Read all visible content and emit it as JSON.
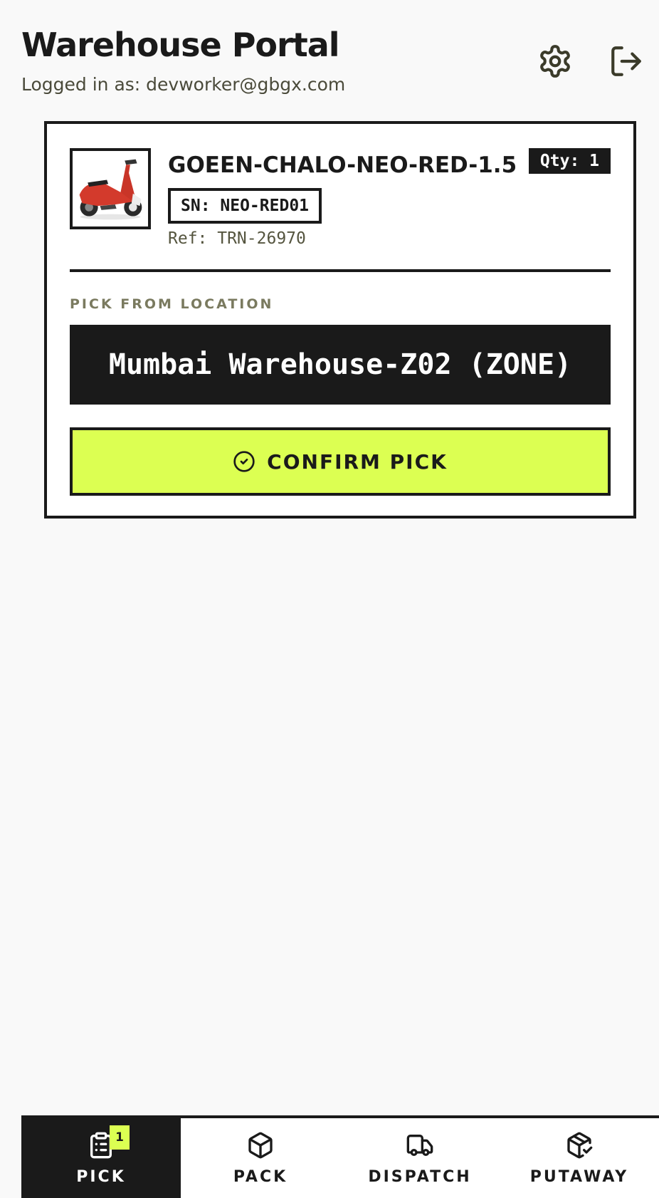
{
  "header": {
    "title": "Warehouse Portal",
    "logged_in": "Logged in as: devworker@gbgx.com",
    "settings_icon": "settings-gear-icon",
    "logout_icon": "logout-icon"
  },
  "task": {
    "product_name": "GOEEN-CHALO-NEO-RED-1.5",
    "qty": "Qty: 1",
    "serial": "SN: NEO-RED01",
    "ref": "Ref: TRN-26970",
    "image_icon": "scooter-image",
    "location_label": "PICK FROM LOCATION",
    "location": "Mumbai Warehouse-Z02 (ZONE)",
    "confirm_label": "CONFIRM PICK",
    "confirm_icon": "check-circle-icon"
  },
  "nav": {
    "tabs": [
      {
        "label": "PICK",
        "icon": "clipboard-list-icon",
        "badge": "1",
        "active": true
      },
      {
        "label": "PACK",
        "icon": "box-icon",
        "active": false
      },
      {
        "label": "DISPATCH",
        "icon": "truck-icon",
        "active": false
      },
      {
        "label": "PUTAWAY",
        "icon": "package-check-icon",
        "active": false
      }
    ]
  },
  "colors": {
    "accent": "#dcff52",
    "dark": "#1a1a1a",
    "background": "#f9f9f9"
  }
}
